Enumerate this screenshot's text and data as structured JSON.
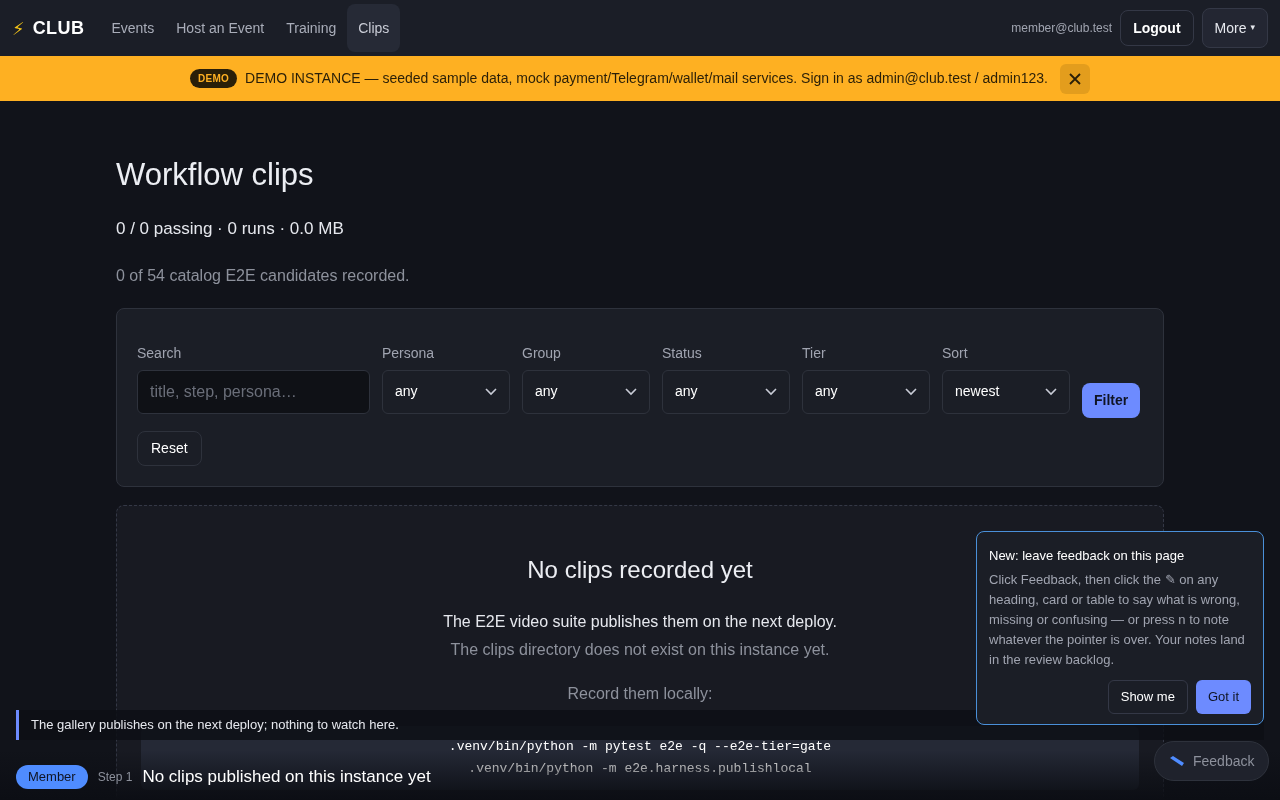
{
  "nav": {
    "logo_glyph": "⚡",
    "brand": "CLUB",
    "links": [
      {
        "label": "Events",
        "selected": false
      },
      {
        "label": "Host an Event",
        "selected": false
      },
      {
        "label": "Training",
        "selected": false
      },
      {
        "label": "Clips",
        "selected": true
      }
    ],
    "user_email": "member@club.test",
    "logout": "Logout",
    "more": "More",
    "more_caret": "▾"
  },
  "banner": {
    "badge": "DEMO",
    "text": "DEMO INSTANCE — seeded sample data, mock payment/Telegram/wallet/mail services. Sign in as admin@club.test / admin123."
  },
  "page": {
    "title": "Workflow clips",
    "stats": "0 / 0 passing · 0 runs · 0.0 MB",
    "note": "0 of 54 catalog E2E candidates recorded."
  },
  "filters": {
    "search": {
      "label": "Search",
      "placeholder": "title, step, persona…"
    },
    "selects": [
      {
        "label": "Persona",
        "value": "any"
      },
      {
        "label": "Group",
        "value": "any"
      },
      {
        "label": "Status",
        "value": "any"
      },
      {
        "label": "Tier",
        "value": "any"
      },
      {
        "label": "Sort",
        "value": "newest"
      }
    ],
    "filter_button": "Filter",
    "reset_button": "Reset"
  },
  "empty_state": {
    "title": "No clips recorded yet",
    "line_1": "The E2E video suite publishes them on the next deploy.",
    "line_2": "The clips directory does not exist on this instance yet.",
    "record_label": "Record them locally:",
    "commands": [
      ".venv/bin/python -m pytest e2e -q --e2e-tier=gate",
      ".venv/bin/python -m e2e.harness.publishlocal"
    ]
  },
  "feedback_popup": {
    "title": "New: leave feedback on this page",
    "body": "Click Feedback, then click the ✎ on any heading, card or table to say what is wrong, missing or confusing — or press n to note whatever the pointer is over. Your notes land in the review backlog.",
    "show_me": "Show me",
    "got_it": "Got it"
  },
  "tour": {
    "callout": "The gallery publishes on the next deploy; nothing to watch here.",
    "persona_badge": "Member",
    "step": "Step 1",
    "step_title": "No clips published on this instance yet"
  },
  "feedback_button": "Feedback"
}
